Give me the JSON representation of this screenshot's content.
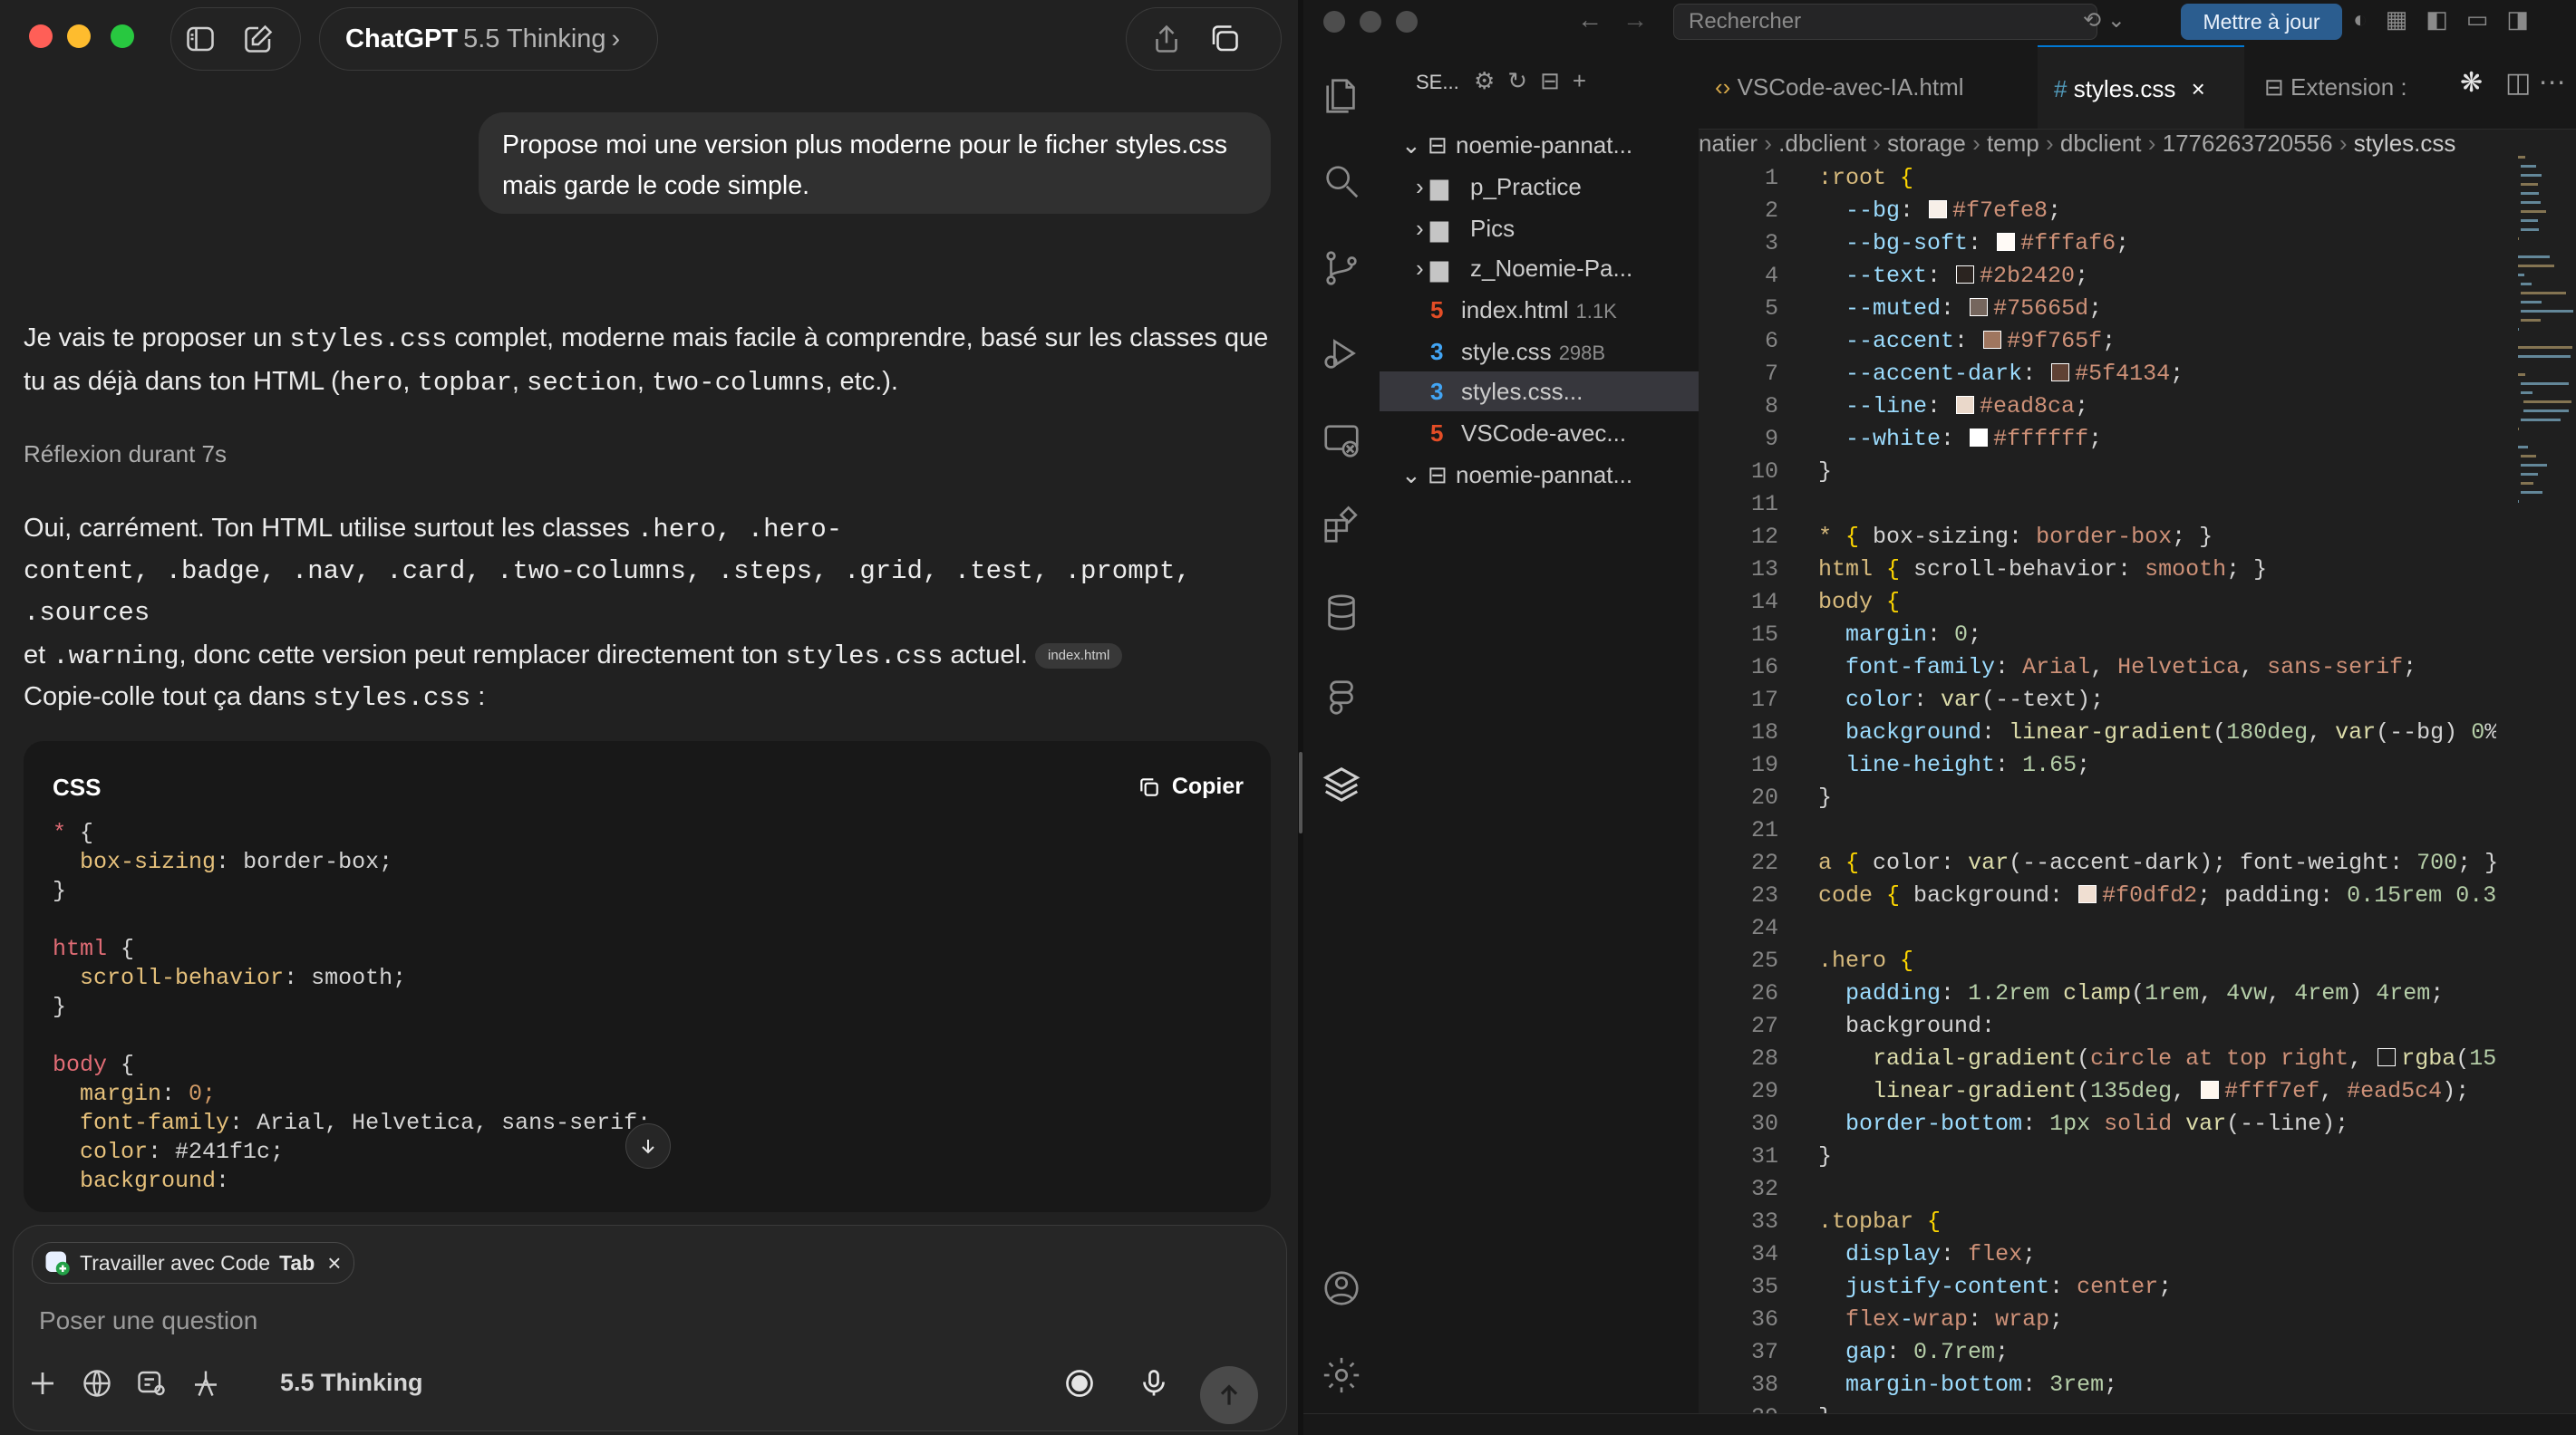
{
  "chat": {
    "app_name": "ChatGPT",
    "model_version": "5.5 Thinking",
    "user_message": "Propose moi une version plus moderne pour le ficher styles.css mais garde le code simple.",
    "intro_before": "Je vais te proposer un ",
    "intro_code": "styles.css",
    "intro_after": " complet, moderne mais facile à comprendre, basé sur les classes que tu as déjà dans ton HTML (",
    "intro_cls1": "hero",
    "intro_cls2": "topbar",
    "intro_cls3": "section",
    "intro_cls4": "two-columns",
    "intro_end": ", etc.).",
    "reflection": "Réflexion durant 7s",
    "answer_start": "Oui, carrément. Ton HTML utilise surtout les classes ",
    "answer_classes_1": ".hero, .hero-",
    "answer_classes_2": "content, .badge, .nav, .card, .two-columns, .steps, .grid, .test, .prompt, .sources",
    "answer_et": "et ",
    "answer_warning": ".warning",
    "answer_end": ", donc cette version peut remplacer directement ton ",
    "answer_file": "styles.css",
    "answer_actuel": " actuel.",
    "source_chip": "index.html",
    "copy_prompt_before": "Copie-colle tout ça dans ",
    "copy_prompt_file": "styles.css",
    "copy_prompt_after": " :",
    "code_lang": "CSS",
    "copy_button": "Copier",
    "code_text": "* {\n  box-sizing: border-box;\n}\n\nhtml {\n  scroll-behavior: smooth;\n}\n\nbody {\n  margin: 0;\n  font-family: Arial, Helvetica, sans-serif;\n  color: #241f1c;\n  background:",
    "context_chip_prefix": "Travailler avec Code",
    "context_chip_tab": "Tab",
    "input_placeholder": "Poser une question",
    "thinking_label": "5.5 Thinking"
  },
  "vscode": {
    "search_placeholder": "Rechercher",
    "update_button": "Mettre à jour",
    "explorer_title": "SE...",
    "tree": [
      {
        "label": "noemie-pannat...",
        "kind": "root",
        "size": ""
      },
      {
        "label": "p_Practice",
        "kind": "folder",
        "size": ""
      },
      {
        "label": "Pics",
        "kind": "folder",
        "size": ""
      },
      {
        "label": "z_Noemie-Pa...",
        "kind": "folder",
        "size": ""
      },
      {
        "label": "index.html",
        "kind": "html",
        "size": "1.1K"
      },
      {
        "label": "style.css",
        "kind": "css",
        "size": "298B"
      },
      {
        "label": "styles.css...",
        "kind": "css",
        "size": ""
      },
      {
        "label": "VSCode-avec...",
        "kind": "html",
        "size": ""
      },
      {
        "label": "noemie-pannat...",
        "kind": "root",
        "size": ""
      }
    ],
    "tabs": [
      {
        "label": "VSCode-avec-IA.html",
        "active": false
      },
      {
        "label": "styles.css",
        "active": true
      },
      {
        "label": "Extension :",
        "active": false
      }
    ],
    "breadcrumb": [
      "natier",
      ".dbclient",
      "storage",
      "temp",
      "dbclient",
      "1776263720556",
      "styles.css"
    ],
    "code_lines": [
      ":root {",
      "  --bg: #f7efe8;",
      "  --bg-soft: #fffaf6;",
      "  --text: #2b2420;",
      "  --muted: #75665d;",
      "  --accent: #9f765f;",
      "  --accent-dark: #5f4134;",
      "  --line: #ead8ca;",
      "  --white: #ffffff;",
      "}",
      "",
      "* { box-sizing: border-box; }",
      "html { scroll-behavior: smooth; }",
      "body {",
      "  margin: 0;",
      "  font-family: Arial, Helvetica, sans-serif;",
      "  color: var(--text);",
      "  background: linear-gradient(180deg, var(--bg) 0%",
      "  line-height: 1.65;",
      "}",
      "",
      "a { color: var(--accent-dark); font-weight: 700; }",
      "code { background: #f0dfd2; padding: 0.15rem 0.3",
      "",
      ".hero {",
      "  padding: 1.2rem clamp(1rem, 4vw, 4rem) 4rem;",
      "  background:",
      "    radial-gradient(circle at top right, rgba(15",
      "    linear-gradient(135deg, #fff7ef, #ead5c4);",
      "  border-bottom: 1px solid var(--line);",
      "}",
      "",
      ".topbar {",
      "  display: flex;",
      "  justify-content: center;",
      "  flex-wrap: wrap;",
      "  gap: 0.7rem;",
      "  margin-bottom: 3rem;",
      "}"
    ],
    "swatches": {
      "2": "#f7efe8",
      "3": "#fffaf6",
      "4": "#2b2420",
      "5": "#75665d",
      "6": "#9f765f",
      "7": "#5f4134",
      "8": "#ead8ca",
      "9": "#ffffff",
      "23": "#f0dfd2",
      "28": "#1f1f1f",
      "29": "#fff7ef"
    }
  }
}
